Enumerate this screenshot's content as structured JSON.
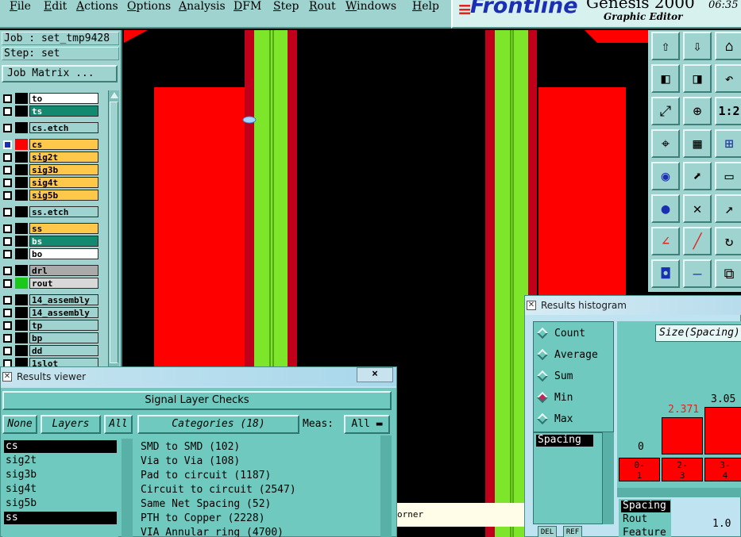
{
  "menu": [
    "File",
    "Edit",
    "Actions",
    "Options",
    "Analysis",
    "DFM",
    "Step",
    "Rout",
    "Windows",
    "Help"
  ],
  "brand": {
    "logo": "Frontline",
    "product": "Genesis 2000",
    "subtitle": "Graphic Editor",
    "clock": "06:35"
  },
  "job": {
    "job_line": "Job : set_tmp9428",
    "step_line": "Step: set",
    "matrix_button": "Job Matrix ..."
  },
  "layers": [
    {
      "name": "to",
      "color": "#ffffff",
      "swatch": "#000000"
    },
    {
      "name": "ts",
      "color": "#138a6f",
      "swatch": "#000000"
    },
    {
      "name": "cs.etch",
      "color": "#9fd3cf",
      "swatch": "#000000"
    },
    {
      "name": "cs",
      "color": "#ffc84a",
      "swatch": "#ff0000",
      "checked": true
    },
    {
      "name": "sig2t",
      "color": "#ffc84a",
      "swatch": "#000000"
    },
    {
      "name": "sig3b",
      "color": "#ffc84a",
      "swatch": "#000000"
    },
    {
      "name": "sig4t",
      "color": "#ffc84a",
      "swatch": "#000000"
    },
    {
      "name": "sig5b",
      "color": "#ffc84a",
      "swatch": "#000000"
    },
    {
      "name": "ss.etch",
      "color": "#9fd3cf",
      "swatch": "#000000"
    },
    {
      "name": "ss",
      "color": "#ffc84a",
      "swatch": "#000000"
    },
    {
      "name": "bs",
      "color": "#138a6f",
      "swatch": "#000000"
    },
    {
      "name": "bo",
      "color": "#ffffff",
      "swatch": "#000000"
    },
    {
      "name": "drl",
      "color": "#aaaaaa",
      "swatch": "#000000"
    },
    {
      "name": "rout",
      "color": "#d8d8d8",
      "swatch": "#1bc91b"
    },
    {
      "name": "14_assembly",
      "color": "#9fd3cf",
      "swatch": "#000000"
    },
    {
      "name": "14_assembly",
      "color": "#9fd3cf",
      "swatch": "#000000"
    },
    {
      "name": "tp",
      "color": "#9fd3cf",
      "swatch": "#000000"
    },
    {
      "name": "bp",
      "color": "#9fd3cf",
      "swatch": "#000000"
    },
    {
      "name": "dd",
      "color": "#9fd3cf",
      "swatch": "#000000"
    },
    {
      "name": "1slot",
      "color": "#9fd3cf",
      "swatch": "#000000"
    }
  ],
  "canvas": {
    "status_text": "orner"
  },
  "tools": [
    "upload-icon",
    "download-icon",
    "home-icon",
    "pan-left-icon",
    "pan-right-icon",
    "undo-zoom-icon",
    "fit-screen-icon",
    "center-icon",
    "scale-one-to-two-icon",
    "snap-icon",
    "grid-icon",
    "net-icon",
    "pad-icon",
    "select-icon",
    "ruler-icon",
    "connect-icon",
    "cross-icon",
    "move-icon",
    "line-icon",
    "diagonal-icon",
    "rotate-icon",
    "add-pad-icon",
    "flip-icon",
    "compare-icon"
  ],
  "tool_labels": {
    "scale": "1:2"
  },
  "results_viewer": {
    "title": "Results viewer",
    "close": "×",
    "header": "Signal Layer Checks",
    "btn_none": "None",
    "btn_layers": "Layers",
    "btn_all": "All",
    "categories_btn": "Categories (18)",
    "meas_label": "Meas:",
    "meas_value": "All",
    "layers": [
      "cs",
      "sig2t",
      "sig3b",
      "sig4t",
      "sig5b",
      "ss"
    ],
    "categories": [
      "SMD to SMD (102)",
      "Via to Via (108)",
      "Pad to circuit (1187)",
      "Circuit to circuit (2547)",
      "Same Net Spacing (52)",
      "PTH to Copper (2228)",
      "VIA Annular ring (4700)"
    ]
  },
  "histogram": {
    "title": "Results histogram",
    "radios": [
      "Count",
      "Average",
      "Sum",
      "Min",
      "Max"
    ],
    "selected": "Min",
    "list_item": "Spacing",
    "size_label": "Size(Spacing)",
    "bars": [
      {
        "bin": "0-1",
        "value": 0
      },
      {
        "bin": "2-3",
        "value": 2.371
      },
      {
        "bin": "3-4",
        "value": 3.05
      }
    ],
    "bar_labels": [
      "0",
      "2.371",
      "3.05"
    ],
    "bin_labels": [
      "0-\n1",
      "2-\n3",
      "3-\n4"
    ],
    "features": [
      "Spacing",
      "Rout",
      "Feature"
    ],
    "scale_value": "1.0",
    "bottom_buttons": [
      "DEL",
      "REF"
    ]
  }
}
